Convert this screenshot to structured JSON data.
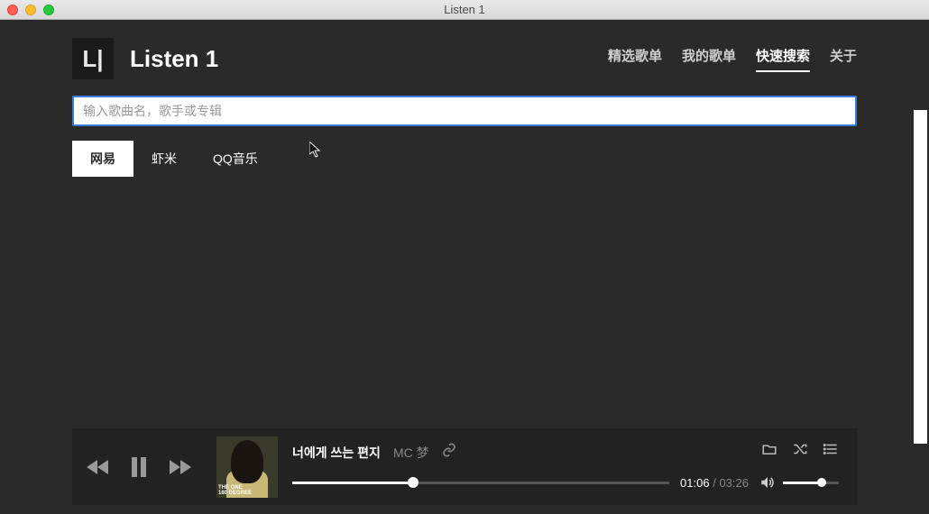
{
  "window": {
    "title": "Listen 1"
  },
  "header": {
    "logo_text": "L|",
    "app_name": "Listen 1"
  },
  "nav": {
    "items": [
      {
        "label": "精选歌单",
        "active": false
      },
      {
        "label": "我的歌单",
        "active": false
      },
      {
        "label": "快速搜索",
        "active": true
      },
      {
        "label": "关于",
        "active": false
      }
    ]
  },
  "search": {
    "placeholder": "输入歌曲名，歌手或专辑",
    "value": ""
  },
  "source_tabs": [
    {
      "label": "网易",
      "active": true
    },
    {
      "label": "虾米",
      "active": false
    },
    {
      "label": "QQ音乐",
      "active": false
    }
  ],
  "player": {
    "track_title": "너에게 쓰는 편지",
    "artist": "MC 梦",
    "time_current": "01:06",
    "time_total": "03:26",
    "album_overlay_line1": "THE ONE",
    "album_overlay_line2": "180 DEGREE"
  }
}
